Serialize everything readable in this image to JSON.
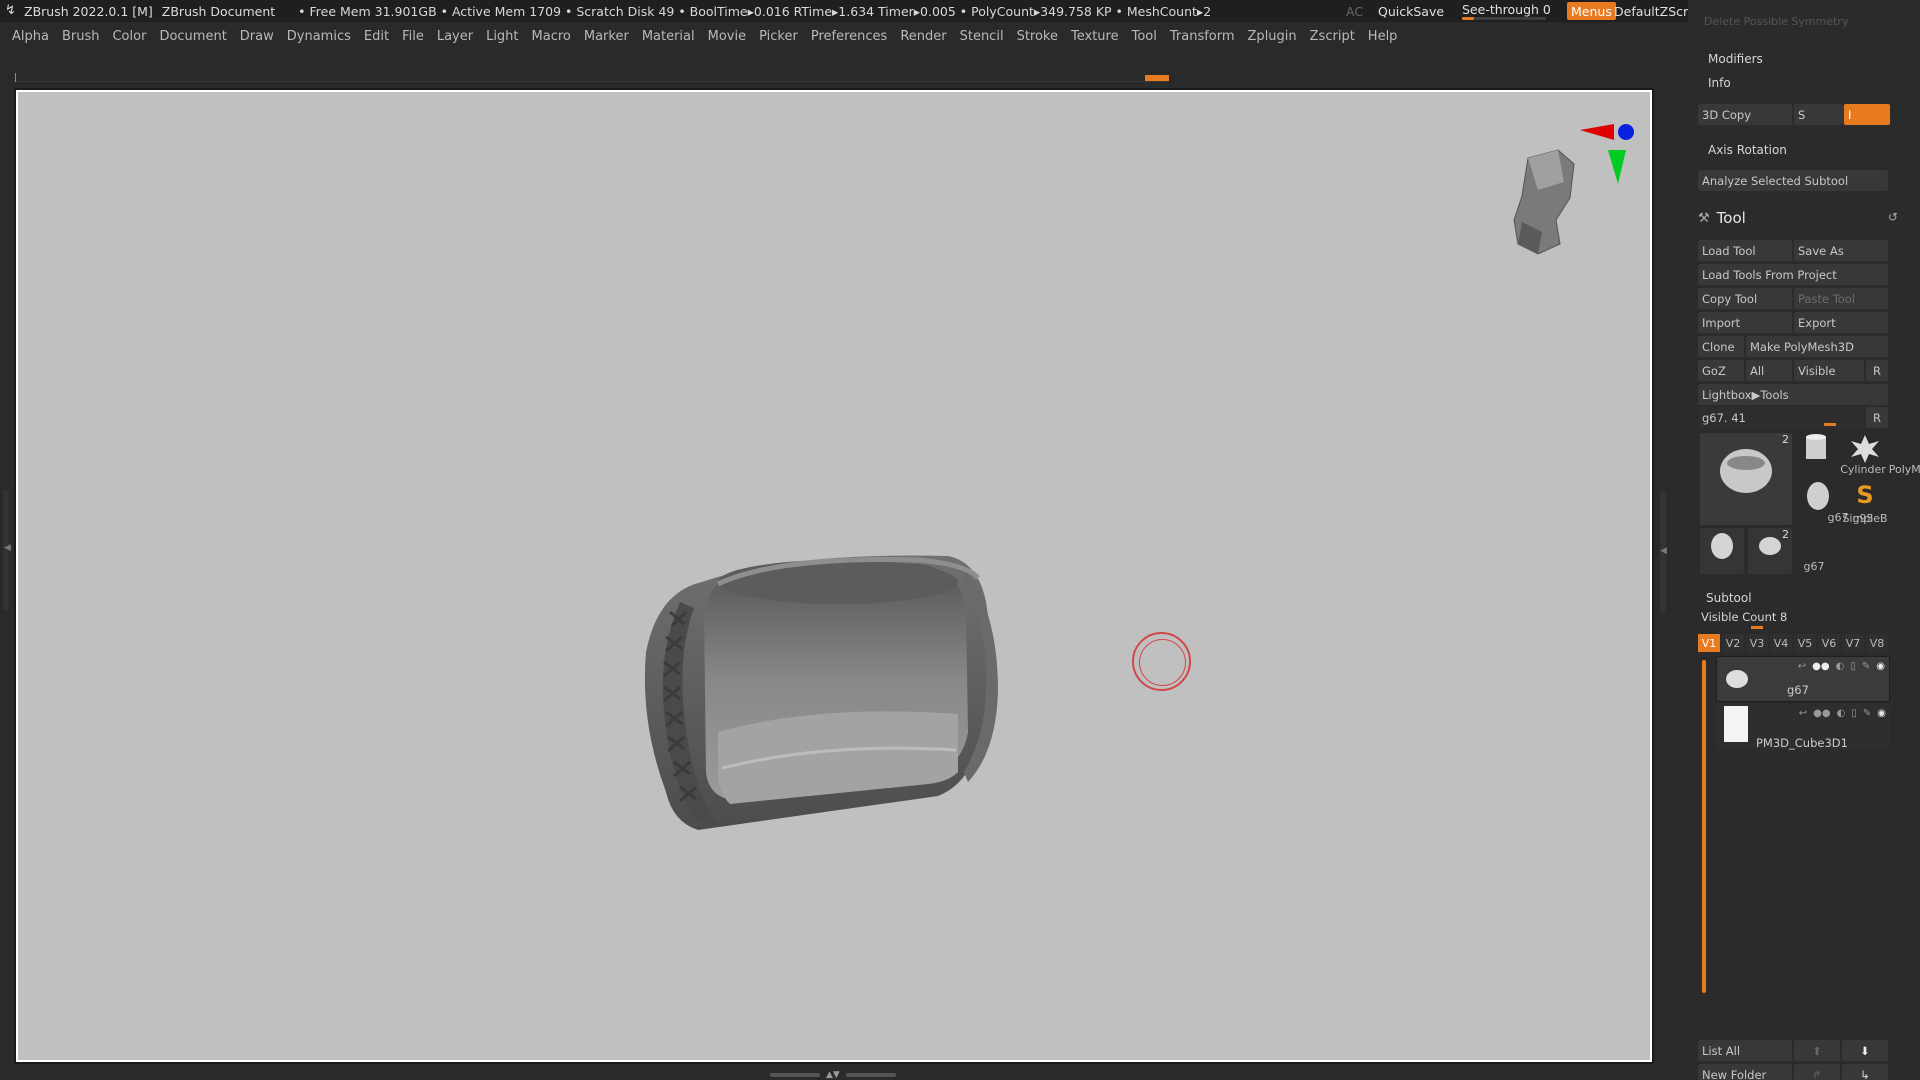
{
  "titlebar": {
    "app": "ZBrush 2022.0.1 [M]",
    "document": "ZBrush Document",
    "stats": "• Free Mem 31.901GB • Active Mem 1709 • Scratch Disk 49 • BoolTime▸0.016 RTime▸1.634 Timer▸0.005 • PolyCount▸349.758 KP • MeshCount▸2",
    "ac": "AC",
    "quicksave": "QuickSave",
    "seethrough": "See-through  0",
    "menus": "Menus",
    "default_zscript": "DefaultZScript"
  },
  "menubar": [
    "Alpha",
    "Brush",
    "Color",
    "Document",
    "Draw",
    "Dynamics",
    "Edit",
    "File",
    "Layer",
    "Light",
    "Macro",
    "Marker",
    "Material",
    "Movie",
    "Picker",
    "Preferences",
    "Render",
    "Stencil",
    "Stroke",
    "Texture",
    "Tool",
    "Transform",
    "Zplugin",
    "Zscript",
    "Help"
  ],
  "panel": {
    "cut_top": "Delete Possible Symmetry",
    "modifiers": "Modifiers",
    "info": "Info",
    "copy3d": "3D Copy",
    "s": "S",
    "i": "I",
    "axis_rotation": "Axis Rotation",
    "analyze": "Analyze Selected Subtool",
    "tool_title": "Tool",
    "load_tool": "Load Tool",
    "save_as": "Save As",
    "load_from_project": "Load Tools From Project",
    "copy_tool": "Copy Tool",
    "paste_tool": "Paste Tool",
    "import": "Import",
    "export": "Export",
    "clone": "Clone",
    "make_polymesh": "Make PolyMesh3D",
    "goz": "GoZ",
    "all": "All",
    "visible": "Visible",
    "r": "R",
    "lightbox_tools": "Lightbox▶Tools",
    "current_tool": "g67. 41",
    "r2": "R",
    "thumbs": [
      {
        "label": "g67",
        "num": "2"
      },
      {
        "label": "Cylinder",
        "num": ""
      },
      {
        "label": "PolyMes",
        "num": ""
      },
      {
        "label": "g95",
        "num": ""
      },
      {
        "label": "SimpleB",
        "num": ""
      },
      {
        "label": "g91",
        "num": ""
      },
      {
        "label": "g67",
        "num": "2"
      }
    ],
    "subtool": "Subtool",
    "visible_count": "Visible Count 8",
    "vtabs": [
      "V1",
      "V2",
      "V3",
      "V4",
      "V5",
      "V6",
      "V7",
      "V8"
    ],
    "subtools": [
      {
        "name": "g67"
      },
      {
        "name": "PM3D_Cube3D1"
      }
    ],
    "list_all": "List All",
    "new_folder": "New Folder"
  }
}
